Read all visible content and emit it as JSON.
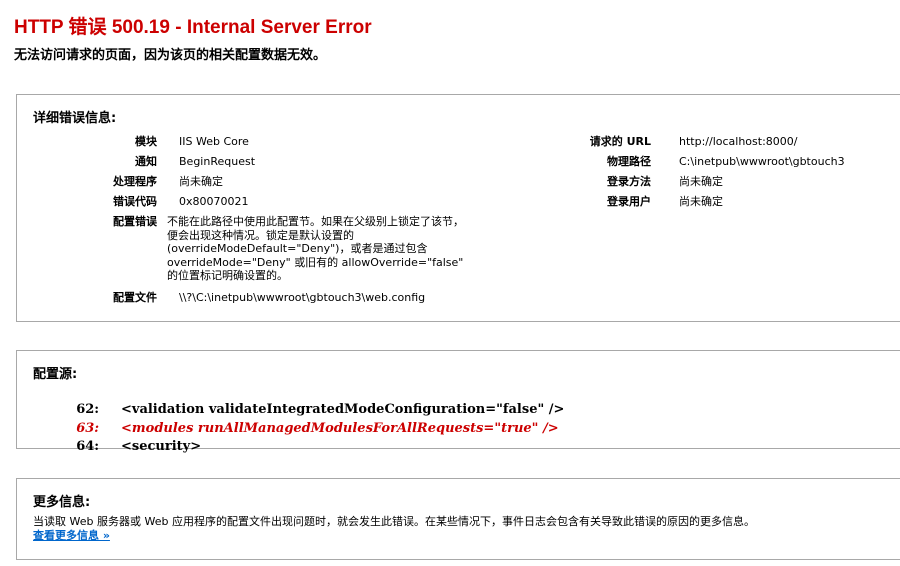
{
  "header": {
    "title": "HTTP 错误 500.19 - Internal Server Error",
    "subtitle": "无法访问请求的页面，因为该页的相关配置数据无效。"
  },
  "details": {
    "heading": "详细错误信息:",
    "left": [
      {
        "label": "模块",
        "value": "IIS Web Core"
      },
      {
        "label": "通知",
        "value": "BeginRequest"
      },
      {
        "label": "处理程序",
        "value": "尚未确定"
      },
      {
        "label": "错误代码",
        "value": "0x80070021"
      },
      {
        "label": "配置错误",
        "value": "不能在此路径中使用此配置节。如果在父级别上锁定了该节，\n便会出现这种情况。锁定是默认设置的\n(overrideModeDefault=\"Deny\")，或者是通过包含\noverrideMode=\"Deny\" 或旧有的 allowOverride=\"false\"\n的位置标记明确设置的。"
      },
      {
        "label": "配置文件",
        "value": "\\\\?\\C:\\inetpub\\wwwroot\\gbtouch3\\web.config"
      }
    ],
    "right": [
      {
        "label": "请求的 URL",
        "value": "http://localhost:8000/"
      },
      {
        "label": "物理路径",
        "value": "C:\\inetpub\\wwwroot\\gbtouch3"
      },
      {
        "label": "登录方法",
        "value": "尚未确定"
      },
      {
        "label": "登录用户",
        "value": "尚未确定"
      }
    ]
  },
  "config_source": {
    "heading": "配置源:",
    "lines": [
      {
        "num": "62:",
        "code": "<validation validateIntegratedModeConfiguration=\"false\" />"
      },
      {
        "num": "63:",
        "code": "<modules runAllManagedModulesForAllRequests=\"true\" />"
      },
      {
        "num": "64:",
        "code": "<security>"
      }
    ]
  },
  "more_info": {
    "heading": "更多信息:",
    "text": "当读取 Web 服务器或 Web 应用程序的配置文件出现问题时，就会发生此错误。在某些情况下，事件日志会包含有关导致此错误的原因的更多信息。",
    "link": "查看更多信息 »"
  },
  "colors": {
    "error_red": "#cc0000",
    "link_blue": "#0066cc",
    "border_gray": "#a8a8a8"
  }
}
